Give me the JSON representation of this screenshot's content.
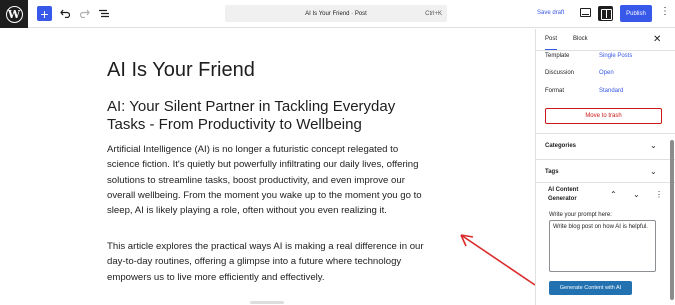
{
  "topbar": {
    "logo_glyph": "W",
    "add_icon": "plus-icon",
    "undo_icon": "undo-icon",
    "redo_icon": "redo-icon",
    "outline_icon": "list-view-icon",
    "command_title": "AI Is Your Friend · Post",
    "command_shortcut": "Ctrl+K",
    "save_draft": "Save draft",
    "publish": "Publish",
    "accent_color": "#3858e9"
  },
  "editor": {
    "title": "AI Is Your Friend",
    "heading": "AI: Your Silent Partner in Tackling Everyday Tasks - From Productivity to Wellbeing",
    "paragraph1": "Artificial Intelligence (AI) is no longer a futuristic concept relegated to science fiction. It's quietly but powerfully infiltrating our daily lives, offering solutions to streamline tasks, boost productivity, and even improve our overall wellbeing. From the moment you wake up to the moment you go to sleep, AI is likely playing a role, often without you even realizing it.",
    "paragraph2": "This article explores the practical ways AI is making a real difference in our day-to-day routines, offering a glimpse into a future where technology empowers us to live more efficiently and effectively."
  },
  "sidebar": {
    "tabs": [
      {
        "label": "Post",
        "active": true
      },
      {
        "label": "Block",
        "active": false
      }
    ],
    "close_glyph": "✕",
    "meta": [
      {
        "label": "Template",
        "value": "Single Posts"
      },
      {
        "label": "Discussion",
        "value": "Open"
      },
      {
        "label": "Format",
        "value": "Standard"
      }
    ],
    "trash_label": "Move to trash",
    "panels": [
      {
        "label": "Categories"
      },
      {
        "label": "Tags"
      }
    ],
    "ai_panel": {
      "title": "AI Content Generator",
      "prompt_label": "Write your prompt here:",
      "prompt_value": "Write blog post on how AI is helpful.",
      "button_label": "Generate Content with AI"
    }
  }
}
